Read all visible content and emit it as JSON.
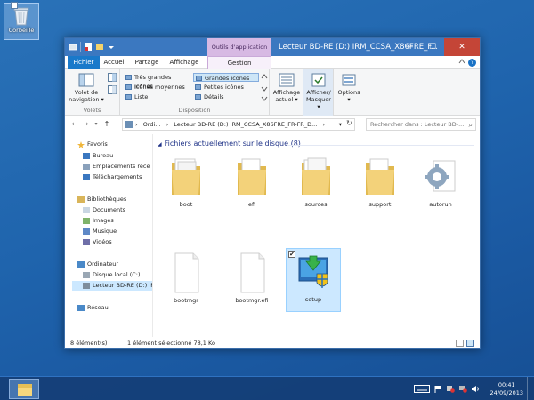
{
  "desktop": {
    "recycle_bin_label": "Corbeille"
  },
  "window": {
    "title": "Lecteur BD-RE (D:) IRM_CCSA_X86FRE_F...",
    "context_tab_header": "Outils d'application",
    "controls": {
      "minimize": "—",
      "maximize": "☐",
      "close": "✕"
    }
  },
  "ribbon_tabs": {
    "file": "Fichier",
    "home": "Accueil",
    "share": "Partage",
    "view": "Affichage",
    "manage": "Gestion",
    "collapse_icon": "chevron-up-icon",
    "help_icon": "help-icon",
    "help_glyph": "?"
  },
  "ribbon": {
    "panes_group": {
      "nav_pane_label": "Volet de navigation ▾",
      "group_label": "Volets"
    },
    "layout_group": {
      "options": [
        {
          "label": "Très grandes icônes",
          "selected": false
        },
        {
          "label": "Grandes icônes",
          "selected": true
        },
        {
          "label": "Icônes moyennes",
          "selected": false
        },
        {
          "label": "Petites icônes",
          "selected": false
        },
        {
          "label": "Liste",
          "selected": false
        },
        {
          "label": "Détails",
          "selected": false
        }
      ],
      "group_label": "Disposition"
    },
    "current_view_label": "Affichage actuel ▾",
    "show_hide_label": "Afficher/ Masquer ▾",
    "options_label": "Options",
    "options_arrow": "▾"
  },
  "address_bar": {
    "crumbs": [
      "Ordi...",
      "Lecteur BD-RE (D:) IRM_CCSA_X86FRE_FR-FR_D..."
    ],
    "separator": "›",
    "dropdown_arrow": "▾",
    "refresh_glyph": "↻",
    "search_placeholder": "Rechercher dans : Lecteur BD-...",
    "search_glyph": "⌕",
    "nav": {
      "back": "←",
      "forward": "→",
      "recent": "▾",
      "up": "↑"
    }
  },
  "nav_pane": {
    "favorites": "Favoris",
    "favorites_items": [
      "Bureau",
      "Emplacements réce",
      "Téléchargements"
    ],
    "libraries": "Bibliothèques",
    "libraries_items": [
      "Documents",
      "Images",
      "Musique",
      "Vidéos"
    ],
    "computer": "Ordinateur",
    "computer_items": [
      "Disque local (C:)",
      "Lecteur BD-RE (D:) IR"
    ],
    "network": "Réseau"
  },
  "content": {
    "group_header": "Fichiers actuellement sur le disque (8)",
    "group_arrow": "◢",
    "files": [
      {
        "name": "boot",
        "type": "folder",
        "selected": false
      },
      {
        "name": "efi",
        "type": "folder",
        "selected": false
      },
      {
        "name": "sources",
        "type": "folder",
        "selected": false
      },
      {
        "name": "support",
        "type": "folder",
        "selected": false
      },
      {
        "name": "autorun",
        "type": "settings-file",
        "selected": false
      },
      {
        "name": "bootmgr",
        "type": "file",
        "selected": false
      },
      {
        "name": "bootmgr.efi",
        "type": "file",
        "selected": false
      },
      {
        "name": "setup",
        "type": "installer",
        "selected": true
      }
    ],
    "checkbox_glyph": "✔"
  },
  "status_bar": {
    "count": "8 élément(s)",
    "selection": "1 élément sélectionné  78,1 Ko"
  },
  "taskbar": {
    "time": "00:41",
    "date": "24/09/2013"
  }
}
